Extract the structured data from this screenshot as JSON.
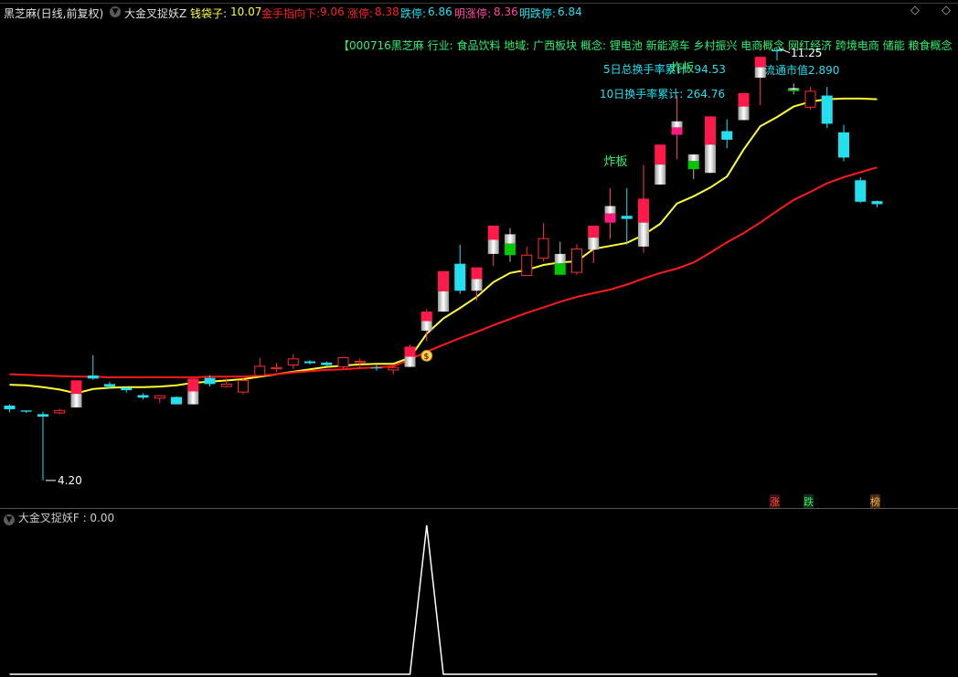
{
  "header": {
    "stock": "黑芝麻(日线,前复权)",
    "indicator": "大金叉捉妖Z",
    "wallet_label": "钱袋子:",
    "wallet_value": "10.07",
    "golden_label": "金手指向下:",
    "golden_value": "9.06",
    "limitup_label": "涨停:",
    "limitup_value": "8.38",
    "limitdown_label": "跌停:",
    "limitdown_value": "6.86",
    "next_up_label": "明涨停:",
    "next_up_value": "8.36",
    "next_down_label": "明跌停:",
    "next_down_value": "6.84"
  },
  "info": {
    "stock_line": "【000716黑芝麻  行业: 食品饮料  地域: 广西板块  概念: 锂电池 新能源车 乡村振兴 电商概念 网红经济 跨境电商 储能 粮食概念",
    "turnover5_label": "5日总换手率累计:",
    "turnover5_value": "94.53",
    "turnover10_label": "10日换手率累计:",
    "turnover10_value": "264.76",
    "market_cap_label": "流通市值",
    "market_cap_value": "2.890"
  },
  "annotations": {
    "high_label": "11.25",
    "low_label": "4.20",
    "explode1": "炸板",
    "explode2": "炸板"
  },
  "badges": {
    "up": "涨",
    "down": "跌",
    "rank": "榜"
  },
  "subpanel": {
    "title": "大金叉捉妖F",
    "value": ": 0.00"
  },
  "colors": {
    "up_candle": "#ff2d2d",
    "down_candle": "#22e0f0",
    "yellow_ma": "#ffff33",
    "red_ma": "#ff1a1a",
    "limit_red": "#ff1a4a",
    "limit_green": "#00c800"
  },
  "chart_data": {
    "type": "candlestick",
    "ylim": [
      4.0,
      11.5
    ],
    "candles": [
      {
        "o": 5.43,
        "c": 5.37,
        "h": 5.45,
        "l": 5.32,
        "style": "cyan"
      },
      {
        "o": 5.35,
        "c": 5.33,
        "h": 5.35,
        "l": 5.31,
        "style": "cyan"
      },
      {
        "o": 5.29,
        "c": 5.25,
        "h": 5.33,
        "l": 4.21,
        "style": "cyan"
      },
      {
        "o": 5.31,
        "c": 5.35,
        "h": 5.38,
        "l": 5.29,
        "style": "hollow"
      },
      {
        "o": 5.4,
        "c": 5.84,
        "h": 5.84,
        "l": 5.4,
        "style": "limitup"
      },
      {
        "o": 5.92,
        "c": 5.87,
        "h": 6.25,
        "l": 5.85,
        "style": "cyan"
      },
      {
        "o": 5.78,
        "c": 5.74,
        "h": 5.82,
        "l": 5.7,
        "style": "cyan"
      },
      {
        "o": 5.72,
        "c": 5.68,
        "h": 5.74,
        "l": 5.64,
        "style": "cyan"
      },
      {
        "o": 5.6,
        "c": 5.56,
        "h": 5.63,
        "l": 5.53,
        "style": "cyan"
      },
      {
        "o": 5.55,
        "c": 5.59,
        "h": 5.6,
        "l": 5.47,
        "style": "hollow"
      },
      {
        "o": 5.57,
        "c": 5.45,
        "h": 5.58,
        "l": 5.45,
        "style": "cyan"
      },
      {
        "o": 5.45,
        "c": 5.87,
        "h": 5.87,
        "l": 5.45,
        "style": "limitup"
      },
      {
        "o": 5.88,
        "c": 5.78,
        "h": 5.92,
        "l": 5.74,
        "style": "cyan"
      },
      {
        "o": 5.74,
        "c": 5.78,
        "h": 5.88,
        "l": 5.72,
        "style": "hollow"
      },
      {
        "o": 5.65,
        "c": 5.84,
        "h": 5.88,
        "l": 5.61,
        "style": "hollow"
      },
      {
        "o": 5.92,
        "c": 6.07,
        "h": 6.21,
        "l": 5.92,
        "style": "hollow"
      },
      {
        "o": 6.03,
        "c": 6.05,
        "h": 6.13,
        "l": 5.98,
        "style": "hollow"
      },
      {
        "o": 6.09,
        "c": 6.19,
        "h": 6.27,
        "l": 6.03,
        "style": "hollow"
      },
      {
        "o": 6.15,
        "c": 6.12,
        "h": 6.17,
        "l": 6.1,
        "style": "cyan"
      },
      {
        "o": 6.13,
        "c": 6.09,
        "h": 6.15,
        "l": 6.07,
        "style": "cyan"
      },
      {
        "o": 6.06,
        "c": 6.21,
        "h": 6.21,
        "l": 6.03,
        "style": "hollow"
      },
      {
        "o": 6.13,
        "c": 6.15,
        "h": 6.2,
        "l": 6.03,
        "style": "hollow"
      },
      {
        "o": 6.05,
        "c": 6.04,
        "h": 6.09,
        "l": 6.0,
        "style": "cyan"
      },
      {
        "o": 6.01,
        "c": 6.05,
        "h": 6.08,
        "l": 5.94,
        "style": "hollow"
      },
      {
        "o": 6.06,
        "c": 6.39,
        "h": 6.42,
        "l": 6.06,
        "style": "limitup"
      },
      {
        "o": 6.65,
        "c": 6.96,
        "h": 7.0,
        "l": 6.48,
        "style": "limitup"
      },
      {
        "o": 6.96,
        "c": 7.62,
        "h": 7.62,
        "l": 6.96,
        "style": "limitup"
      },
      {
        "o": 7.74,
        "c": 7.3,
        "h": 8.05,
        "l": 7.25,
        "style": "cyan"
      },
      {
        "o": 7.3,
        "c": 7.68,
        "h": 7.68,
        "l": 7.14,
        "style": "limitup"
      },
      {
        "o": 7.9,
        "c": 8.36,
        "h": 8.36,
        "l": 7.7,
        "style": "limitup"
      },
      {
        "o": 8.22,
        "c": 7.88,
        "h": 8.32,
        "l": 7.77,
        "style": "limitdown"
      },
      {
        "o": 7.55,
        "c": 7.88,
        "h": 8.02,
        "l": 7.55,
        "style": "hollow"
      },
      {
        "o": 7.83,
        "c": 8.15,
        "h": 8.4,
        "l": 7.78,
        "style": "hollow"
      },
      {
        "o": 7.9,
        "c": 7.56,
        "h": 8.1,
        "l": 7.56,
        "style": "limitdown"
      },
      {
        "o": 7.6,
        "c": 7.98,
        "h": 8.06,
        "l": 7.56,
        "style": "hollow"
      },
      {
        "o": 7.97,
        "c": 8.36,
        "h": 8.36,
        "l": 7.75,
        "style": "limitup"
      },
      {
        "o": 8.41,
        "c": 8.68,
        "h": 8.97,
        "l": 8.14,
        "style": "explode"
      },
      {
        "o": 8.52,
        "c": 8.47,
        "h": 8.97,
        "l": 8.05,
        "style": "cyan"
      },
      {
        "o": 8.02,
        "c": 8.8,
        "h": 9.35,
        "l": 7.92,
        "style": "limitup"
      },
      {
        "o": 9.03,
        "c": 9.68,
        "h": 9.68,
        "l": 9.03,
        "style": "limitup"
      },
      {
        "o": 9.84,
        "c": 10.06,
        "h": 10.48,
        "l": 9.44,
        "style": "explode"
      },
      {
        "o": 9.52,
        "c": 9.28,
        "h": 9.52,
        "l": 9.12,
        "style": "limitdown"
      },
      {
        "o": 9.22,
        "c": 10.14,
        "h": 10.14,
        "l": 9.22,
        "style": "limitup"
      },
      {
        "o": 9.9,
        "c": 9.76,
        "h": 10.09,
        "l": 9.62,
        "style": "cyan"
      },
      {
        "o": 10.08,
        "c": 10.52,
        "h": 10.52,
        "l": 10.08,
        "style": "limitup"
      },
      {
        "o": 10.77,
        "c": 11.11,
        "h": 11.11,
        "l": 10.32,
        "style": "limitup"
      },
      {
        "o": 11.22,
        "c": 11.2,
        "h": 11.25,
        "l": 11.05,
        "style": "cyan"
      },
      {
        "o": 10.6,
        "c": 10.55,
        "h": 10.68,
        "l": 10.5,
        "style": "limitdown"
      },
      {
        "o": 10.29,
        "c": 10.55,
        "h": 10.62,
        "l": 10.25,
        "style": "hollow"
      },
      {
        "o": 10.48,
        "c": 10.02,
        "h": 10.62,
        "l": 9.95,
        "style": "cyan"
      },
      {
        "o": 9.88,
        "c": 9.47,
        "h": 10.0,
        "l": 9.41,
        "style": "cyan"
      },
      {
        "o": 9.1,
        "c": 8.75,
        "h": 9.15,
        "l": 8.73,
        "style": "cyan"
      },
      {
        "o": 8.76,
        "c": 8.71,
        "h": 8.77,
        "l": 8.66,
        "style": "cyan"
      }
    ],
    "yellow_ma": [
      5.77,
      5.76,
      5.73,
      5.69,
      5.63,
      5.7,
      5.72,
      5.73,
      5.73,
      5.74,
      5.76,
      5.8,
      5.82,
      5.84,
      5.86,
      5.9,
      5.94,
      5.98,
      6.02,
      6.06,
      6.08,
      6.1,
      6.11,
      6.11,
      6.21,
      6.6,
      6.85,
      7.02,
      7.2,
      7.44,
      7.59,
      7.64,
      7.72,
      7.76,
      7.78,
      7.98,
      8.03,
      8.08,
      8.21,
      8.39,
      8.72,
      8.84,
      8.98,
      9.16,
      9.6,
      9.98,
      10.13,
      10.3,
      10.38,
      10.42,
      10.43,
      10.43,
      10.42
    ],
    "red_ma": [
      5.94,
      5.93,
      5.92,
      5.91,
      5.9,
      5.9,
      5.89,
      5.89,
      5.89,
      5.89,
      5.89,
      5.89,
      5.9,
      5.9,
      5.9,
      5.92,
      5.94,
      5.97,
      5.99,
      6.01,
      6.02,
      6.04,
      6.05,
      6.07,
      6.18,
      6.31,
      6.42,
      6.53,
      6.63,
      6.74,
      6.84,
      6.94,
      7.03,
      7.12,
      7.2,
      7.26,
      7.32,
      7.4,
      7.5,
      7.59,
      7.66,
      7.76,
      7.92,
      8.09,
      8.24,
      8.41,
      8.6,
      8.78,
      8.91,
      9.05,
      9.15,
      9.23,
      9.31
    ],
    "sub_indicator": {
      "name": "大金叉捉妖F",
      "value": 0.0,
      "spike_index": 25,
      "spike_value": 1
    }
  }
}
